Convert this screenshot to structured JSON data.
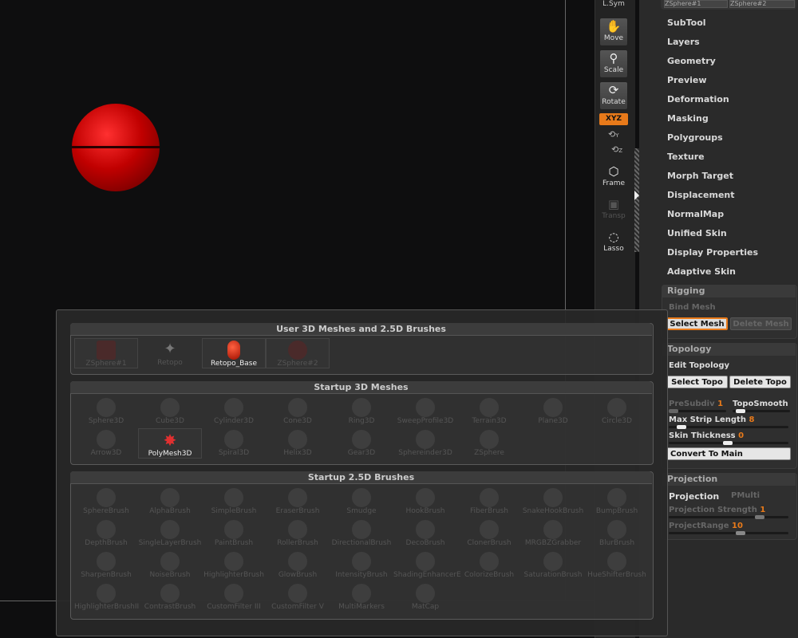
{
  "shelf": {
    "lsym": "L.Sym",
    "move": "Move",
    "scale": "Scale",
    "rotate": "Rotate",
    "xyz": "XYZ",
    "y_icon": "Y",
    "z_icon": "Z",
    "frame": "Frame",
    "transp": "Transp",
    "lasso": "Lasso"
  },
  "subtool_slots": [
    "ZSphere#1",
    "ZSphere#2"
  ],
  "menu": [
    "SubTool",
    "Layers",
    "Geometry",
    "Preview",
    "Deformation",
    "Masking",
    "Polygroups",
    "Texture",
    "Morph Target",
    "Displacement",
    "NormalMap",
    "Unified Skin",
    "Display Properties",
    "Adaptive Skin"
  ],
  "rigging": {
    "title": "Rigging",
    "bind_mesh": "Bind Mesh",
    "select_mesh": "Select Mesh",
    "delete_mesh": "Delete Mesh"
  },
  "topology": {
    "title": "Topology",
    "edit_topology": "Edit Topology",
    "select_topo": "Select Topo",
    "delete_topo": "Delete Topo",
    "presubdiv_label": "PreSubdiv",
    "presubdiv_value": "1",
    "toposmooth_label": "TopoSmooth",
    "max_strip_label": "Max Strip Length",
    "max_strip_value": "8",
    "skin_thickness_label": "Skin Thickness",
    "skin_thickness_value": "0",
    "convert_to_main": "Convert To Main"
  },
  "projection": {
    "title": "Projection",
    "projection_label": "Projection",
    "pmulti_label": "PMulti",
    "strength_label": "Projection Strength",
    "strength_value": "1",
    "range_label": "ProjectRange",
    "range_value": "10"
  },
  "popup": {
    "user_title": "User 3D Meshes and 2.5D Brushes",
    "user_items": [
      "ZSphere#1",
      "Retopo",
      "Retopo_Base",
      "ZSphere#2"
    ],
    "startup3d_title": "Startup 3D Meshes",
    "startup3d_row1": [
      "Sphere3D",
      "Cube3D",
      "Cylinder3D",
      "Cone3D",
      "Ring3D",
      "SweepProfile3D",
      "Terrain3D",
      "Plane3D",
      "Circle3D"
    ],
    "startup3d_row2": [
      "Arrow3D",
      "PolyMesh3D",
      "Spiral3D",
      "Helix3D",
      "Gear3D",
      "Sphereinder3D",
      "ZSphere"
    ],
    "brushes_title": "Startup 2.5D Brushes",
    "brushes_row1": [
      "SphereBrush",
      "AlphaBrush",
      "SimpleBrush",
      "EraserBrush",
      "Smudge",
      "HookBrush",
      "FiberBrush",
      "SnakeHookBrush",
      "BumpBrush"
    ],
    "brushes_row2": [
      "DepthBrush",
      "SingleLayerBrush",
      "PaintBrush",
      "RollerBrush",
      "DirectionalBrush",
      "DecoBrush",
      "ClonerBrush",
      "MRGBZGrabber",
      "BlurBrush"
    ],
    "brushes_row3": [
      "SharpenBrush",
      "NoiseBrush",
      "HighlighterBrush",
      "GlowBrush",
      "IntensityBrush",
      "ShadingEnhancerE",
      "ColorizeBrush",
      "SaturationBrush",
      "HueShifterBrush"
    ],
    "brushes_row4": [
      "HighlighterBrushII",
      "ContrastBrush",
      "CustomFilter III",
      "CustomFilter V",
      "MultiMarkers",
      "MatCap"
    ]
  },
  "colors": {
    "accent": "#e87a1a",
    "sphere": "#cc0000"
  }
}
